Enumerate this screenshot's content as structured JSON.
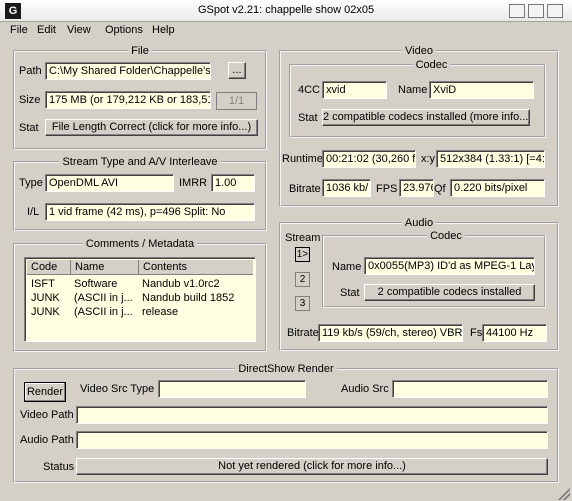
{
  "window": {
    "title": "GSpot v2.21: chappelle show 02x05",
    "icon_glyph": "G"
  },
  "menu": [
    "File",
    "Edit",
    "View",
    "Options",
    "Help"
  ],
  "file": {
    "legend": "File",
    "path_label": "Path",
    "path_value": "C:\\My Shared Folder\\Chappelle's",
    "browse_label": "...",
    "size_label": "Size",
    "size_value": "175 MB (or 179,212 KB or 183,51",
    "page_value": "1/1",
    "stat_label": "Stat",
    "stat_value": "File Length Correct (click for more info...)"
  },
  "stream_type": {
    "legend": "Stream Type and A/V Interleave",
    "type_label": "Type",
    "type_value": "OpenDML AVI",
    "imrr_label": "IMRR",
    "imrr_value": "1.00",
    "il_label": "I/L",
    "il_value": "1 vid frame (42 ms), p=496  Split: No"
  },
  "comments": {
    "legend": "Comments / Metadata",
    "columns": [
      "Code",
      "Name",
      "Contents"
    ],
    "rows": [
      {
        "code": "ISFT",
        "name": "Software",
        "contents": "Nandub v1.0rc2"
      },
      {
        "code": "JUNK",
        "name": "(ASCII in j...",
        "contents": "Nandub build 1852"
      },
      {
        "code": "JUNK",
        "name": "(ASCII in j...",
        "contents": "release"
      }
    ]
  },
  "video": {
    "legend": "Video",
    "codec_legend": "Codec",
    "fourcc_label": "4CC",
    "fourcc_value": "xvid",
    "name_label": "Name",
    "name_value": "XviD",
    "stat_label": "Stat",
    "stat_value": "2 compatible codecs installed (more info...)",
    "runtime_label": "Runtime",
    "runtime_value": "00:21:02 (30,260 fr",
    "xy_label": "x:y",
    "xy_value": "512x384 (1.33:1) [=4:3",
    "bitrate_label": "Bitrate",
    "bitrate_value": "1036 kb/",
    "fps_label": "FPS",
    "fps_value": "23.976",
    "qf_label": "Qf",
    "qf_value": "0.220 bits/pixel"
  },
  "audio": {
    "legend": "Audio",
    "stream_label": "Stream",
    "streams": [
      "1>",
      "2",
      "3"
    ],
    "codec_legend": "Codec",
    "name_label": "Name",
    "name_value": "0x0055(MP3) ID'd as MPEG-1 Laye",
    "stat_label": "Stat",
    "stat_value": "2 compatible codecs installed",
    "bitrate_label": "Bitrate",
    "bitrate_value": "119 kb/s (59/ch, stereo) VBR",
    "fs_label": "Fs",
    "fs_value": "44100 Hz"
  },
  "render": {
    "legend": "DirectShow Render",
    "render_button": "Render",
    "video_src_type_label": "Video Src Type",
    "video_src_type_value": "",
    "audio_src_label": "Audio Src",
    "audio_src_value": "",
    "video_path_label": "Video Path",
    "video_path_value": "",
    "audio_path_label": "Audio Path",
    "audio_path_value": "",
    "status_label": "Status",
    "status_value": "Not yet rendered (click for more info...)"
  }
}
